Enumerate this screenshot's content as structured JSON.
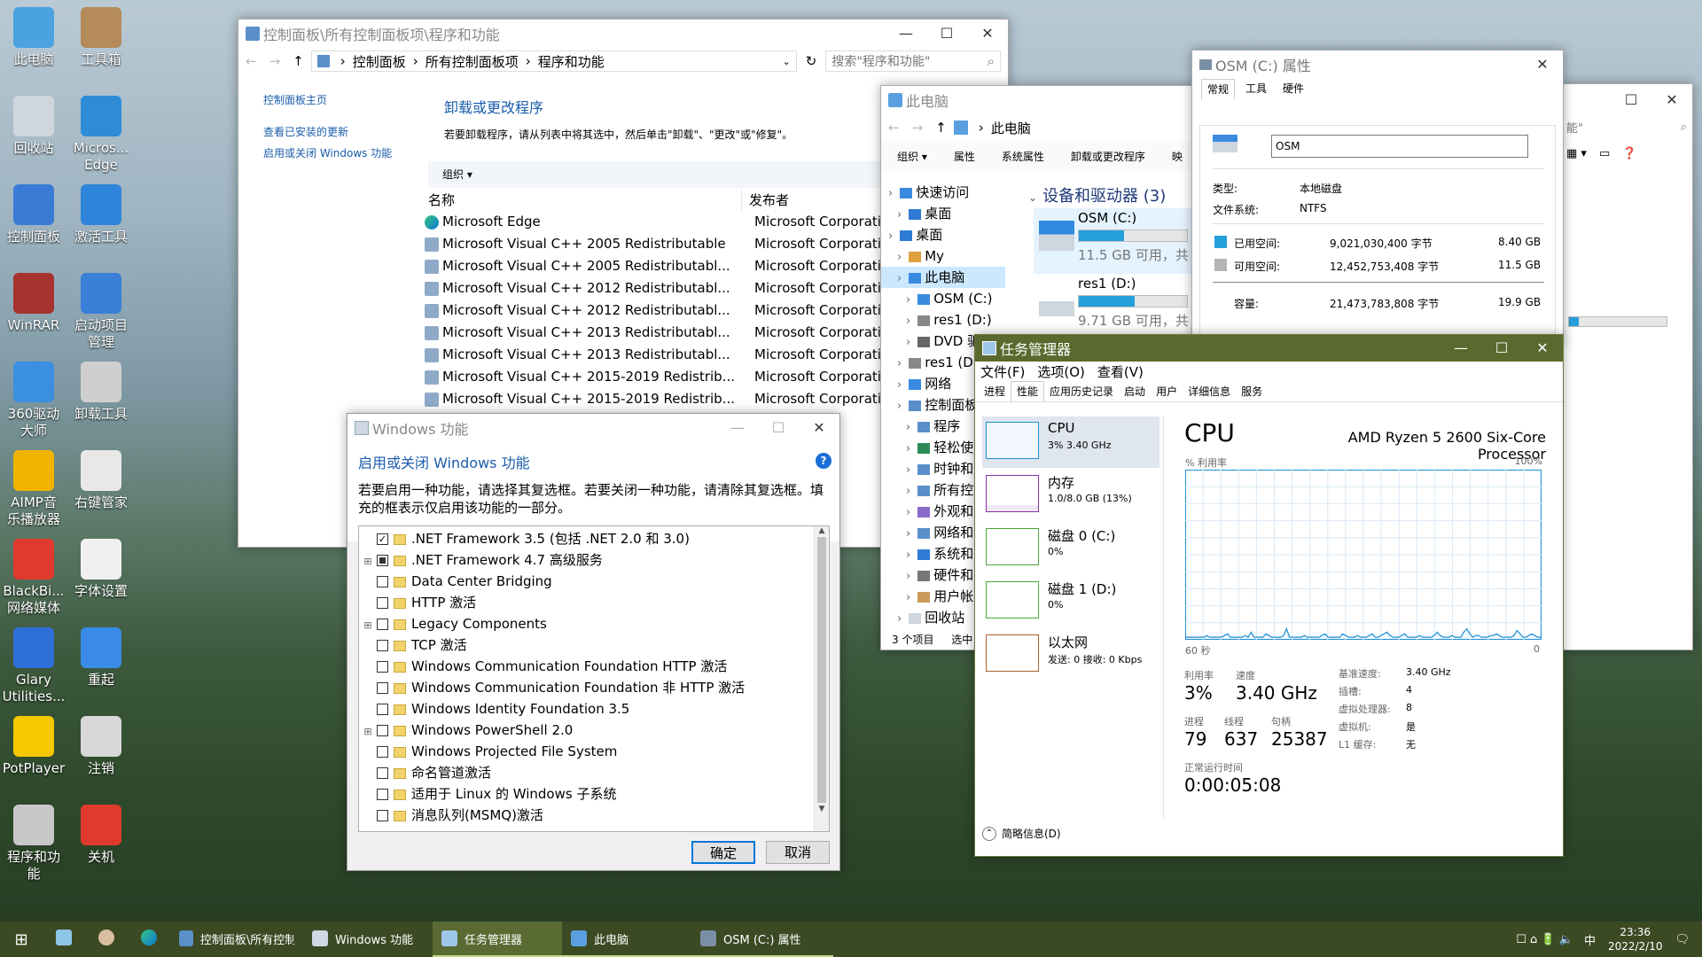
{
  "desktop": {
    "icons": [
      {
        "label": "此电脑"
      },
      {
        "label": "工具箱"
      },
      {
        "label": "回收站"
      },
      {
        "label": "Micros...\nEdge"
      },
      {
        "label": "控制面板"
      },
      {
        "label": "激活工具"
      },
      {
        "label": "WinRAR"
      },
      {
        "label": "启动项目\n管理"
      },
      {
        "label": "360驱动\n大师"
      },
      {
        "label": "卸载工具"
      },
      {
        "label": "AIMP音\n乐播放器"
      },
      {
        "label": "右键管家"
      },
      {
        "label": "BlackBi...\n网络媒体"
      },
      {
        "label": "字体设置"
      },
      {
        "label": "Glary\nUtilities..."
      },
      {
        "label": "重起"
      },
      {
        "label": "PotPlayer"
      },
      {
        "label": "注销"
      },
      {
        "label": "程序和功\n能"
      },
      {
        "label": "关机"
      }
    ]
  },
  "cp": {
    "title": "控制面板\\所有控制面板项\\程序和功能",
    "crumb": [
      "控制面板",
      "所有控制面板项",
      "程序和功能"
    ],
    "search_placeholder": "搜索\"程序和功能\"",
    "side": [
      "控制面板主页",
      "查看已安装的更新",
      "启用或关闭 Windows 功能"
    ],
    "heading": "卸载或更改程序",
    "desc": "若要卸载程序，请从列表中将其选中，然后单击\"卸载\"、\"更改\"或\"修复\"。",
    "organize": "组织 ▾",
    "col_name": "名称",
    "col_pub": "发布者",
    "rows": [
      {
        "name": "Microsoft Edge",
        "pub": "Microsoft Corporatio"
      },
      {
        "name": "Microsoft Visual C++ 2005 Redistributable",
        "pub": "Microsoft Corporatio"
      },
      {
        "name": "Microsoft Visual C++ 2005 Redistributabl...",
        "pub": "Microsoft Corporatio"
      },
      {
        "name": "Microsoft Visual C++ 2012 Redistributabl...",
        "pub": "Microsoft Corporatio"
      },
      {
        "name": "Microsoft Visual C++ 2012 Redistributabl...",
        "pub": "Microsoft Corporatio"
      },
      {
        "name": "Microsoft Visual C++ 2013 Redistributabl...",
        "pub": "Microsoft Corporatio"
      },
      {
        "name": "Microsoft Visual C++ 2013 Redistributabl...",
        "pub": "Microsoft Corporatio"
      },
      {
        "name": "Microsoft Visual C++ 2015-2019 Redistrib...",
        "pub": "Microsoft Corporatio"
      },
      {
        "name": "Microsoft Visual C++ 2015-2019 Redistrib...",
        "pub": "Microsoft Corporatio"
      }
    ]
  },
  "wf": {
    "title": "Windows 功能",
    "heading": "启用或关闭 Windows 功能",
    "desc": "若要启用一种功能，请选择其复选框。若要关闭一种功能，请清除其复选框。填充的框表示仅启用该功能的一部分。",
    "items": [
      {
        "label": ".NET Framework 3.5 (包括 .NET 2.0 和 3.0)",
        "state": "checked",
        "expand": false
      },
      {
        "label": ".NET Framework 4.7 高级服务",
        "state": "partial",
        "expand": true
      },
      {
        "label": "Data Center Bridging",
        "state": "none",
        "expand": false
      },
      {
        "label": "HTTP 激活",
        "state": "none",
        "expand": false
      },
      {
        "label": "Legacy Components",
        "state": "none",
        "expand": true
      },
      {
        "label": "TCP 激活",
        "state": "none",
        "expand": false
      },
      {
        "label": "Windows Communication Foundation HTTP 激活",
        "state": "none",
        "expand": false
      },
      {
        "label": "Windows Communication Foundation 非 HTTP 激活",
        "state": "none",
        "expand": false
      },
      {
        "label": "Windows Identity Foundation 3.5",
        "state": "none",
        "expand": false
      },
      {
        "label": "Windows PowerShell 2.0",
        "state": "none",
        "expand": true
      },
      {
        "label": "Windows Projected File System",
        "state": "none",
        "expand": false
      },
      {
        "label": "命名管道激活",
        "state": "none",
        "expand": false
      },
      {
        "label": "适用于 Linux 的 Windows 子系统",
        "state": "none",
        "expand": false
      },
      {
        "label": "消息队列(MSMQ)激活",
        "state": "none",
        "expand": false
      }
    ],
    "ok": "确定",
    "cancel": "取消"
  },
  "pc": {
    "title": "此电脑",
    "crumb": "此电脑",
    "ribbon": [
      "组织 ▾",
      "属性",
      "系统属性",
      "卸载或更改程序",
      "映"
    ],
    "nav": [
      {
        "label": "快速访问",
        "indent": 0
      },
      {
        "label": "桌面",
        "indent": 1
      },
      {
        "label": "桌面",
        "indent": 0
      },
      {
        "label": "My",
        "indent": 1
      },
      {
        "label": "此电脑",
        "indent": 1,
        "selected": true
      },
      {
        "label": "OSM (C:)",
        "indent": 2
      },
      {
        "label": "res1 (D:)",
        "indent": 2
      },
      {
        "label": "DVD 驱",
        "indent": 2
      },
      {
        "label": "res1 (D",
        "indent": 1
      },
      {
        "label": "网络",
        "indent": 1
      },
      {
        "label": "控制面板",
        "indent": 1
      },
      {
        "label": "程序",
        "indent": 2
      },
      {
        "label": "轻松使",
        "indent": 2
      },
      {
        "label": "时钟和",
        "indent": 2
      },
      {
        "label": "所有控",
        "indent": 2
      },
      {
        "label": "外观和",
        "indent": 2
      },
      {
        "label": "网络和",
        "indent": 2
      },
      {
        "label": "系统和",
        "indent": 2
      },
      {
        "label": "硬件和",
        "indent": 2
      },
      {
        "label": "用户帐",
        "indent": 2
      },
      {
        "label": "回收站",
        "indent": 1
      }
    ],
    "group": "设备和驱动器 (3)",
    "drives": [
      {
        "name": "OSM (C:)",
        "free": "11.5 GB 可用，共",
        "fill": 0.42
      },
      {
        "name": "res1 (D:)",
        "free": "9.71 GB 可用，共",
        "fill": 0.52
      }
    ],
    "status": "3 个项目",
    "status2": "选中"
  },
  "props": {
    "title": "OSM (C:) 属性",
    "tabs": [
      "常规",
      "工具",
      "硬件"
    ],
    "name_value": "OSM",
    "type_label": "类型:",
    "type_value": "本地磁盘",
    "fs_label": "文件系统:",
    "fs_value": "NTFS",
    "used_label": "已用空间:",
    "used_bytes": "9,021,030,400 字节",
    "used_gb": "8.40 GB",
    "free_label": "可用空间:",
    "free_bytes": "12,452,753,408 字节",
    "free_gb": "11.5 GB",
    "cap_label": "容量:",
    "cap_bytes": "21,473,783,808 字节",
    "cap_gb": "19.9 GB",
    "used_color": "#26a0da",
    "free_color": "#b5b5b5"
  },
  "bgwin": {
    "search": "能\""
  },
  "tm": {
    "title": "任务管理器",
    "menu": [
      "文件(F)",
      "选项(O)",
      "查看(V)"
    ],
    "tabs": [
      "进程",
      "性能",
      "应用历史记录",
      "启动",
      "用户",
      "详细信息",
      "服务"
    ],
    "items": [
      {
        "name": "CPU",
        "sub": "3% 3.40 GHz",
        "color": "#1e8ed6"
      },
      {
        "name": "内存",
        "sub": "1.0/8.0 GB (13%)",
        "color": "#8b2fa6"
      },
      {
        "name": "磁盘 0 (C:)",
        "sub": "0%",
        "color": "#4ca63a"
      },
      {
        "name": "磁盘 1 (D:)",
        "sub": "0%",
        "color": "#4ca63a"
      },
      {
        "name": "以太网",
        "sub": "发送: 0 接收: 0 Kbps",
        "color": "#a8622c"
      }
    ],
    "cpu_title": "CPU",
    "cpu_model": "AMD Ryzen 5 2600 Six-Core Processor",
    "util_axis": "% 利用率",
    "max": "100%",
    "sec": "60 秒",
    "zero": "0",
    "util_label": "利用率",
    "util_value": "3%",
    "speed_label": "速度",
    "speed_value": "3.40 GHz",
    "proc_label": "进程",
    "proc_value": "79",
    "thr_label": "线程",
    "thr_value": "637",
    "hnd_label": "句柄",
    "hnd_value": "25387",
    "up_label": "正常运行时间",
    "up_value": "0:00:05:08",
    "spec": [
      {
        "k": "基准速度:",
        "v": "3.40 GHz"
      },
      {
        "k": "插槽:",
        "v": "4"
      },
      {
        "k": "虚拟处理器:",
        "v": "8"
      },
      {
        "k": "虚拟机:",
        "v": "是"
      },
      {
        "k": "L1 缓存:",
        "v": "无"
      }
    ],
    "footer": "简略信息(D)",
    "cpu_history": [
      1,
      1,
      1,
      1,
      1,
      1,
      1,
      2,
      1,
      1,
      1,
      1,
      1,
      2,
      3,
      1,
      1,
      1,
      1,
      1,
      2,
      1,
      4,
      1,
      1,
      1,
      1,
      3,
      2,
      1,
      1,
      1,
      1,
      2,
      6,
      1,
      1,
      1,
      1,
      1,
      2,
      1,
      1,
      1,
      1,
      1,
      2,
      3,
      1,
      1,
      1,
      1,
      1,
      3,
      2,
      1,
      1,
      1,
      2,
      1,
      1,
      1,
      2,
      3,
      1,
      1,
      2,
      3,
      4,
      2,
      1,
      1,
      1,
      2,
      3,
      1,
      1,
      1,
      1,
      2,
      1,
      1,
      1,
      1,
      2,
      4,
      2,
      1,
      1,
      1,
      2,
      1,
      1,
      1,
      4,
      6,
      3,
      1,
      2,
      2,
      1,
      1,
      1,
      2,
      2,
      3,
      2,
      1,
      1,
      1,
      1,
      2,
      5,
      3,
      1,
      1,
      2,
      3,
      2,
      1,
      1
    ]
  },
  "taskbar": {
    "tasks": [
      "控制面板\\所有控制...",
      "Windows 功能",
      "任务管理器",
      "此电脑",
      "OSM (C:) 属性"
    ],
    "time": "23:36",
    "date": "2022/2/10",
    "ime": "中"
  }
}
